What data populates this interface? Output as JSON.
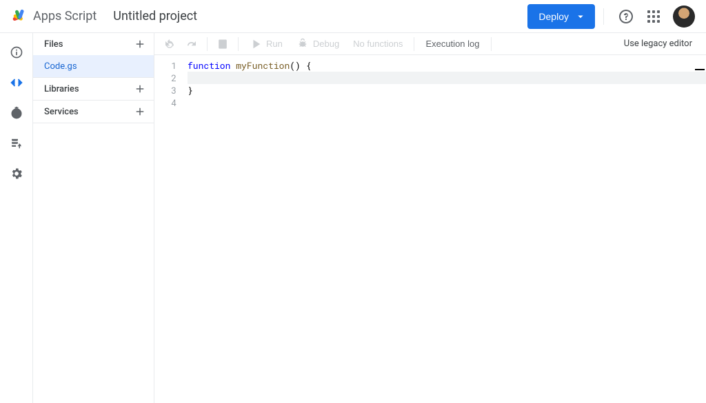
{
  "header": {
    "app_name": "Apps Script",
    "project_title": "Untitled project",
    "deploy_label": "Deploy"
  },
  "sidebar": {
    "sections": [
      {
        "title": "Files",
        "items": [
          {
            "name": "Code.gs",
            "selected": true
          }
        ]
      },
      {
        "title": "Libraries",
        "items": []
      },
      {
        "title": "Services",
        "items": []
      }
    ]
  },
  "toolbar": {
    "run_label": "Run",
    "debug_label": "Debug",
    "function_selector": "No functions",
    "execution_log_label": "Execution log",
    "legacy_link": "Use legacy editor"
  },
  "editor": {
    "lines": [
      {
        "n": "1",
        "tokens": [
          [
            "kw",
            "function"
          ],
          [
            "sp",
            " "
          ],
          [
            "fn",
            "myFunction"
          ],
          [
            "pn",
            "()"
          ],
          [
            "sp",
            " "
          ],
          [
            "br",
            "{"
          ]
        ]
      },
      {
        "n": "2",
        "tokens": [
          [
            "sp",
            "  "
          ]
        ],
        "current": true
      },
      {
        "n": "3",
        "tokens": [
          [
            "br",
            "}"
          ]
        ]
      },
      {
        "n": "4",
        "tokens": []
      }
    ]
  }
}
